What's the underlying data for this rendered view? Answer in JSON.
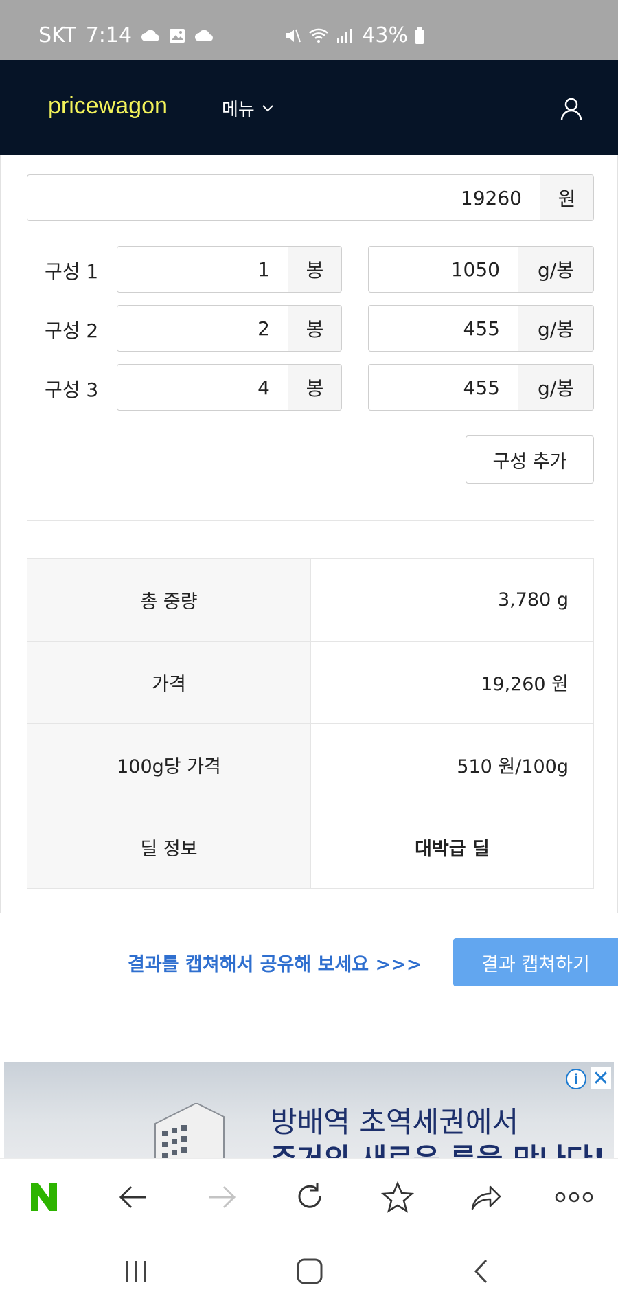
{
  "status_bar": {
    "carrier": "SKT",
    "time": "7:14",
    "battery": "43%",
    "icons": [
      "cloud-icon",
      "gallery-icon",
      "cloud-icon",
      "mute-icon",
      "wifi-icon",
      "signal-icon",
      "battery-icon"
    ]
  },
  "header": {
    "logo": "pricewagon",
    "menu_label": "메뉴",
    "logo_color": "#f2f25a",
    "bg_color": "#061427"
  },
  "price": {
    "value": "19260",
    "unit": "원"
  },
  "components": [
    {
      "label": "구성 1",
      "count": "1",
      "count_unit": "봉",
      "weight": "1050",
      "weight_unit": "g/봉"
    },
    {
      "label": "구성 2",
      "count": "2",
      "count_unit": "봉",
      "weight": "455",
      "weight_unit": "g/봉"
    },
    {
      "label": "구성 3",
      "count": "4",
      "count_unit": "봉",
      "weight": "455",
      "weight_unit": "g/봉"
    }
  ],
  "add_component_label": "구성 추가",
  "results": [
    {
      "key": "총 중량",
      "value": "3,780 g"
    },
    {
      "key": "가격",
      "value": "19,260 원"
    },
    {
      "key": "100g당 가격",
      "value": "510 원/100g"
    },
    {
      "key": "딜 정보",
      "value": "대박급 딜"
    }
  ],
  "capture": {
    "prompt": "결과를 캡쳐해서 공유해 보세요 >>>",
    "button": "결과 캡쳐하기",
    "accent": "#62a6ef"
  },
  "ad": {
    "line1": "방배역 초역세권에서",
    "line2": "주거의 새로운 룩을 만나다!",
    "info": "i",
    "close": "✕"
  },
  "browser_toolbar": [
    "naver-icon",
    "back-icon",
    "forward-icon",
    "refresh-icon",
    "bookmark-icon",
    "share-icon",
    "more-icon"
  ],
  "nav_bar": [
    "recents-icon",
    "home-icon",
    "back-icon"
  ]
}
